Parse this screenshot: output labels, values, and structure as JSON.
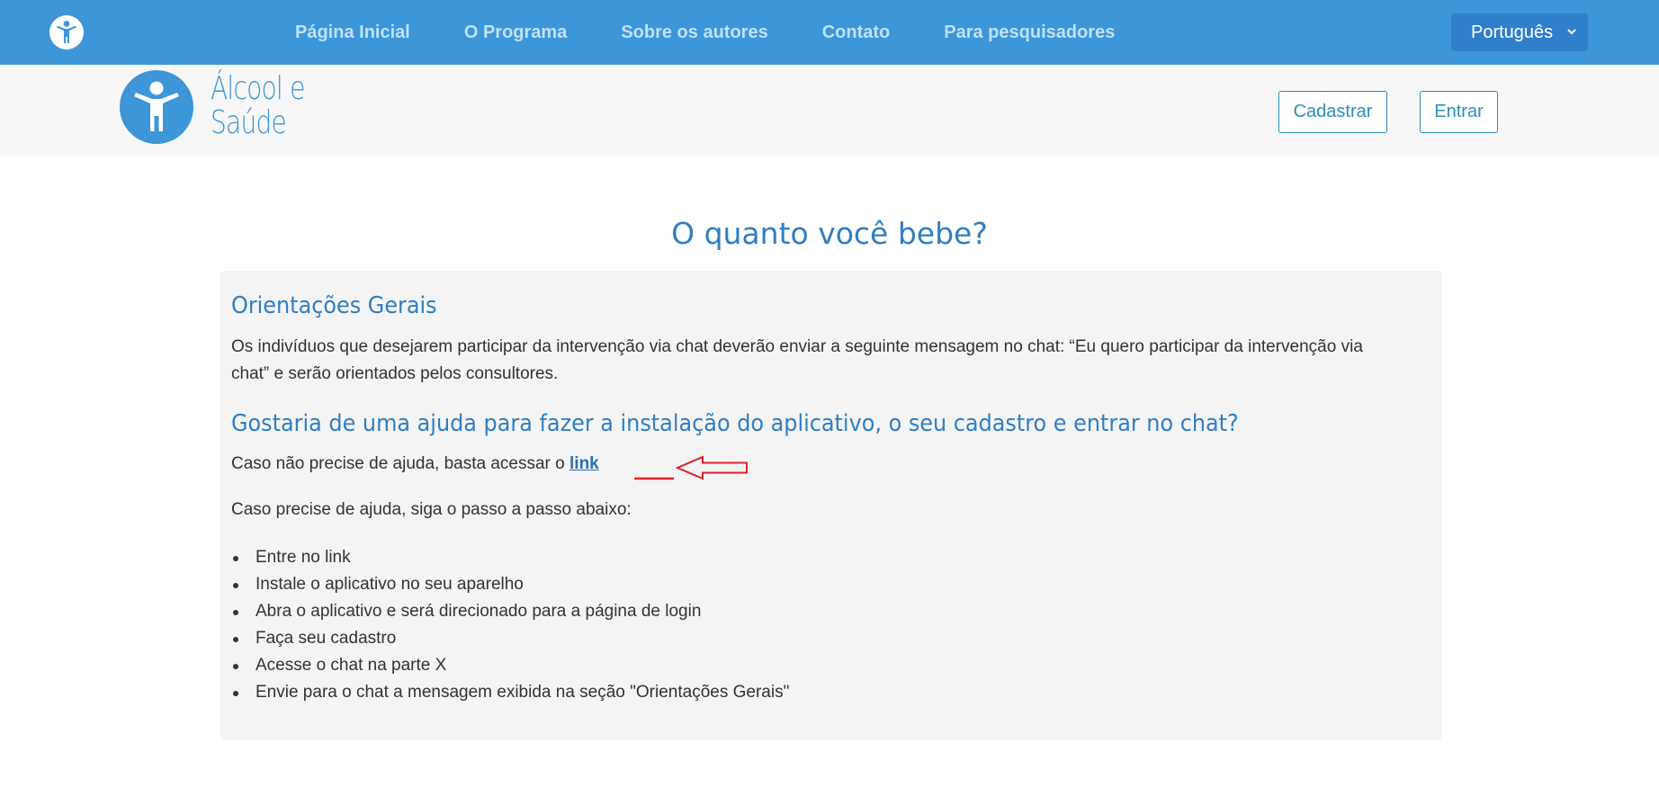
{
  "topnav": {
    "items": [
      {
        "label": "Página Inicial"
      },
      {
        "label": "O Programa"
      },
      {
        "label": "Sobre os autores"
      },
      {
        "label": "Contato"
      },
      {
        "label": "Para pesquisadores"
      }
    ],
    "language": "Português"
  },
  "header": {
    "logo_line1": "Álcool e",
    "logo_line2": "Saúde",
    "register_label": "Cadastrar",
    "login_label": "Entrar"
  },
  "main": {
    "title": "O quanto você bebe?",
    "section1_heading": "Orientações Gerais",
    "section1_text": "Os indivíduos que desejarem participar da intervenção via chat deverão enviar a seguinte mensagem no chat: “Eu quero participar da intervenção via chat” e serão orientados pelos consultores.",
    "section2_heading": "Gostaria de uma ajuda para fazer a instalação do aplicativo, o seu cadastro e entrar no chat?",
    "link_prefix": "Caso não precise de ajuda, basta acessar o ",
    "link_label": "link",
    "steps_intro": "Caso precise de ajuda, siga o passo a passo abaixo:",
    "steps": [
      "Entre no link",
      "Instale o aplicativo no seu aparelho",
      "Abra o aplicativo e será direcionado para a página de login",
      "Faça seu cadastro",
      "Acesse o chat na parte X",
      "Envie para o chat a mensagem exibida na seção \"Orientações Gerais\""
    ]
  },
  "colors": {
    "navbar": "#3c96d8",
    "accent": "#2f7fc1",
    "annotation": "#e0202a"
  },
  "icons": [
    "person-icon",
    "chevron-down-icon",
    "logo-person-icon",
    "annotation-arrow-icon"
  ]
}
